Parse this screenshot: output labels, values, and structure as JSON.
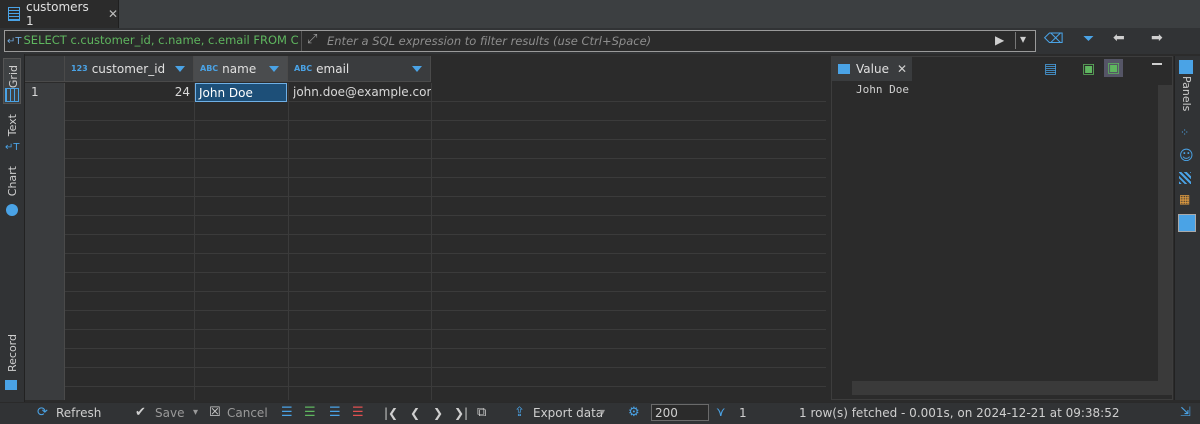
{
  "tab": {
    "label": "customers 1"
  },
  "filter": {
    "sql": "SELECT c.customer_id, c.name, c.email FROM Custo",
    "placeholder": "Enter a SQL expression to filter results (use Ctrl+Space)"
  },
  "left_tabs": {
    "grid": "Grid",
    "text": "Text",
    "chart": "Chart",
    "record": "Record"
  },
  "grid": {
    "columns": [
      {
        "type": "123",
        "label": "customer_id"
      },
      {
        "type": "ABC",
        "label": "name"
      },
      {
        "type": "ABC",
        "label": "email"
      }
    ],
    "rows": [
      {
        "num": "1",
        "customer_id": "24",
        "name": "John Doe",
        "email": "john.doe@example.com"
      }
    ]
  },
  "value_panel": {
    "tab_label": "Value",
    "content": "John Doe"
  },
  "right_bar": {
    "panels_label": "Panels"
  },
  "bottom": {
    "refresh": "Refresh",
    "save": "Save",
    "cancel": "Cancel",
    "export": "Export data",
    "limit": "200",
    "count": "1",
    "status": "1 row(s) fetched - 0.001s, on 2024-12-21 at 09:38:52"
  }
}
